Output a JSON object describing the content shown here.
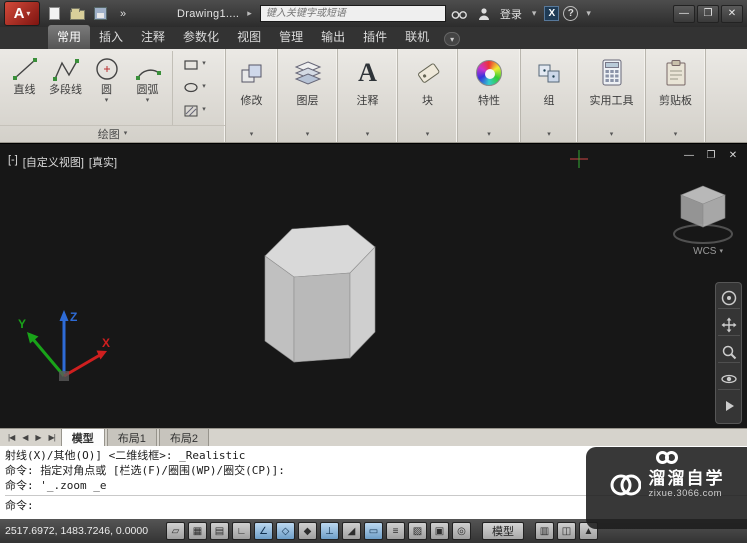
{
  "titlebar": {
    "logo_letter": "A",
    "doc_title": "Drawing1....",
    "search_placeholder": "键入关键字或短语",
    "signin_label": "登录",
    "exchange_label": "X",
    "help_label": "?",
    "minimize": "—",
    "maximize": "❐",
    "close": "✕"
  },
  "glyphs": {
    "chevron_down": "▾",
    "chevron_right": "▸",
    "more": "»",
    "annotation_a": "A"
  },
  "ribbon": {
    "tabs": [
      {
        "label": "常用",
        "active": true
      },
      {
        "label": "插入",
        "active": false
      },
      {
        "label": "注释",
        "active": false
      },
      {
        "label": "参数化",
        "active": false
      },
      {
        "label": "视图",
        "active": false
      },
      {
        "label": "管理",
        "active": false
      },
      {
        "label": "输出",
        "active": false
      },
      {
        "label": "插件",
        "active": false
      },
      {
        "label": "联机",
        "active": false
      }
    ],
    "draw_panel": {
      "label": "绘图",
      "tools": [
        {
          "label": "直线"
        },
        {
          "label": "多段线"
        },
        {
          "label": "圆"
        },
        {
          "label": "圆弧"
        }
      ]
    },
    "collapsed_panels": [
      {
        "label": "修改"
      },
      {
        "label": "图层"
      },
      {
        "label": "注释"
      },
      {
        "label": "块"
      },
      {
        "label": "特性"
      },
      {
        "label": "组"
      },
      {
        "label": "实用工具"
      },
      {
        "label": "剪贴板"
      }
    ]
  },
  "viewport": {
    "control_minus": "[-]",
    "control_view": "[自定义视图]",
    "control_visual": "[真实]",
    "wcs_label": "WCS",
    "win": {
      "minimize": "—",
      "restore": "❐",
      "close": "✕"
    }
  },
  "layout_tabs": {
    "nav_first": "|◀",
    "nav_prev": "◀",
    "nav_next": "▶",
    "nav_last": "▶|",
    "tabs": [
      {
        "label": "模型",
        "active": true
      },
      {
        "label": "布局1",
        "active": false
      },
      {
        "label": "布局2",
        "active": false
      }
    ]
  },
  "command_line": {
    "history": [
      "射线(X)/其他(O)] <二维线框>: _Realistic",
      "命令: 指定对角点或 [栏选(F)/圈围(WP)/圈交(CP)]:",
      "命令: '_.zoom _e"
    ],
    "prompt": "命令:"
  },
  "status_bar": {
    "coordinates": "2517.6972, 1483.7246, 0.0000",
    "model_button": "模型",
    "buttons": [
      {
        "name": "infer-constraints",
        "glyph": "▱"
      },
      {
        "name": "snap-mode",
        "glyph": "▦"
      },
      {
        "name": "grid-display",
        "glyph": "▤"
      },
      {
        "name": "ortho-mode",
        "glyph": "∟"
      },
      {
        "name": "polar-tracking",
        "glyph": "∠"
      },
      {
        "name": "object-snap",
        "glyph": "◇"
      },
      {
        "name": "3d-object-snap",
        "glyph": "◆"
      },
      {
        "name": "object-snap-tracking",
        "glyph": "⊥"
      },
      {
        "name": "dynamic-ucs",
        "glyph": "◢"
      },
      {
        "name": "dynamic-input",
        "glyph": "▭"
      },
      {
        "name": "lineweight",
        "glyph": "≡"
      },
      {
        "name": "transparency",
        "glyph": "▨"
      },
      {
        "name": "quick-properties",
        "glyph": "▣"
      },
      {
        "name": "selection-cycling",
        "glyph": "◎"
      }
    ],
    "right_buttons": [
      {
        "name": "quick-view-layouts",
        "glyph": "▥"
      },
      {
        "name": "quick-view-drawings",
        "glyph": "◫"
      },
      {
        "name": "annotation-scale",
        "glyph": "▲"
      }
    ]
  },
  "watermark": {
    "title": "溜溜自学",
    "url": "zixue.3066.com"
  },
  "colors": {
    "logo_red": "#b2281e",
    "ribbon_bg": "#d9d6cf",
    "viewport_bg": "#171717",
    "axis_x": "#cf1f1f",
    "axis_y": "#19a319",
    "axis_z": "#2e6bd6",
    "status_on": "#6f9fc8"
  }
}
